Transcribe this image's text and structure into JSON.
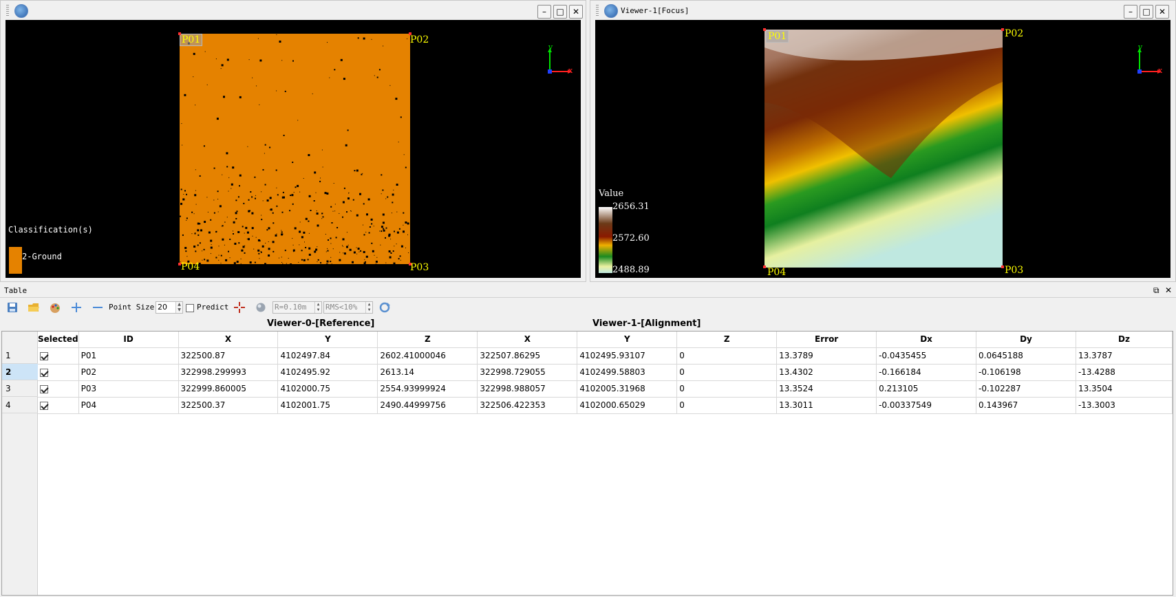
{
  "viewers": [
    {
      "title": "",
      "legend_title": "Classification(s)",
      "legend_items": [
        {
          "label": "2-Ground",
          "color": "#e58200"
        }
      ],
      "points": [
        "P01",
        "P02",
        "P03",
        "P04"
      ],
      "axis_x": "x",
      "axis_y": "y"
    },
    {
      "title": "Viewer-1[Focus]",
      "legend_title": "Value",
      "legend_max": "2656.31",
      "legend_mid": "2572.60",
      "legend_min": "2488.89",
      "points": [
        "P01",
        "P02",
        "P03",
        "P04"
      ],
      "axis_x": "x",
      "axis_y": "y"
    }
  ],
  "window_buttons": {
    "minimize": "–",
    "restore": "□",
    "close": "✕"
  },
  "table_panel": {
    "title": "Table",
    "point_size_label": "Point Size:",
    "point_size_value": "20",
    "predict_label": "Predict",
    "radius_value": "R=0.10m",
    "rms_value": "RMS<10%",
    "group_reference": "Viewer-0-[Reference]",
    "group_alignment": "Viewer-1-[Alignment]",
    "columns": [
      "Selected",
      "ID",
      "X",
      "Y",
      "Z",
      "X",
      "Y",
      "Z",
      "Error",
      "Dx",
      "Dy",
      "Dz"
    ],
    "rows": [
      {
        "num": "1",
        "id": "P01",
        "x1": "322500.87",
        "y1": "4102497.84",
        "z1": "2602.41000046",
        "x2": "322507.86295",
        "y2": "4102495.93107",
        "z2": "0",
        "err": "13.3789",
        "dx": "-0.0435455",
        "dy": "0.0645188",
        "dz": "13.3787"
      },
      {
        "num": "2",
        "id": "P02",
        "x1": "322998.299993",
        "y1": "4102495.92",
        "z1": "2613.14",
        "x2": "322998.729055",
        "y2": "4102499.58803",
        "z2": "0",
        "err": "13.4302",
        "dx": "-0.166184",
        "dy": "-0.106198",
        "dz": "-13.4288"
      },
      {
        "num": "3",
        "id": "P03",
        "x1": "322999.860005",
        "y1": "4102000.75",
        "z1": "2554.93999924",
        "x2": "322998.988057",
        "y2": "4102005.31968",
        "z2": "0",
        "err": "13.3524",
        "dx": "0.213105",
        "dy": "-0.102287",
        "dz": "13.3504"
      },
      {
        "num": "4",
        "id": "P04",
        "x1": "322500.37",
        "y1": "4102001.75",
        "z1": "2490.44999756",
        "x2": "322506.422353",
        "y2": "4102000.65029",
        "z2": "0",
        "err": "13.3011",
        "dx": "-0.00337549",
        "dy": "0.143967",
        "dz": "-13.3003"
      }
    ]
  },
  "colors": {
    "ground": "#e58200",
    "point_label": "#ffff00",
    "selection": "#cde4f7"
  }
}
